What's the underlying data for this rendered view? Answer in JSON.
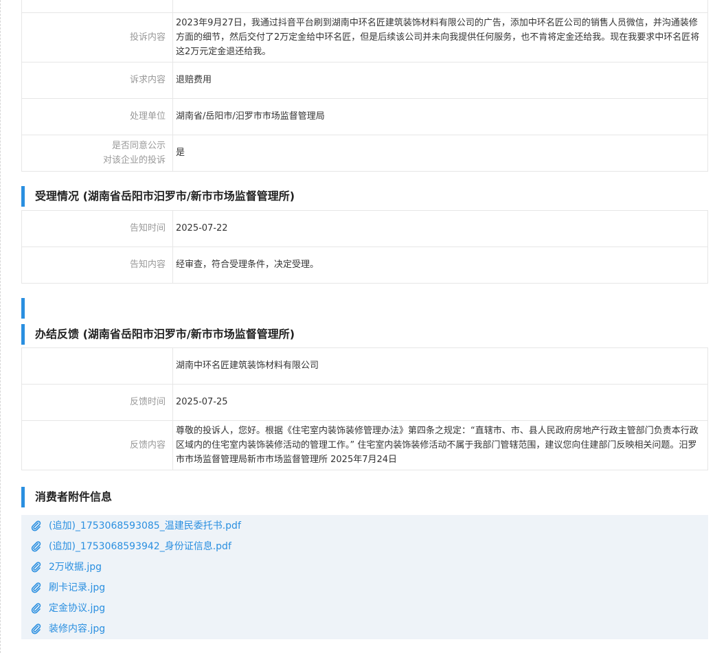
{
  "complaint_table": {
    "rows": [
      {
        "label": "投诉内容",
        "value": "2023年9月27日，我通过抖音平台刷到湖南中环名匠建筑装饰材料有限公司的广告，添加中环名匠公司的销售人员微信，并沟通装修方面的细节，然后交付了2万定金给中环名匠，但是后续该公司并未向我提供任何服务，也不肯将定金还给我。现在我要求中环名匠将这2万元定金退还给我。"
      },
      {
        "label": "诉求内容",
        "value": "退赔费用"
      },
      {
        "label": "处理单位",
        "value": "湖南省/岳阳市/汨罗市市场监督管理局"
      },
      {
        "label_line1": "是否同意公示",
        "label_line2": "对该企业的投诉",
        "value": "是"
      }
    ]
  },
  "acceptance": {
    "title": "受理情况 (湖南省岳阳市汨罗市/新市市场监督管理所)",
    "rows": [
      {
        "label": "告知时间",
        "value": "2025-07-22"
      },
      {
        "label": "告知内容",
        "value": "经审查，符合受理条件，决定受理。"
      }
    ]
  },
  "feedback": {
    "title": "办结反馈 (湖南省岳阳市汨罗市/新市市场监督管理所)",
    "rows": [
      {
        "label": "",
        "value": "湖南中环名匠建筑装饰材料有限公司"
      },
      {
        "label": "反馈时间",
        "value": "2025-07-25"
      },
      {
        "label": "反馈内容",
        "value": "尊敬的投诉人，您好。根据《住宅室内装饰装修管理办法》第四条之规定：“直辖市、市、县人民政府房地产行政主管部门负责本行政区域内的住宅室内装饰装修活动的管理工作。” 住宅室内装饰装修活动不属于我部门管辖范围，建议您向住建部门反映相关问题。汨罗市市场监督管理局新市市场监督管理所 2025年7月24日"
      }
    ]
  },
  "attachments": {
    "title": "消费者附件信息",
    "icon": "paperclip-icon",
    "files": [
      "(追加)_1753068593085_温建民委托书.pdf",
      "(追加)_1753068593942_身份证信息.pdf",
      "2万收据.jpg",
      "刷卡记录.jpg",
      "定金协议.jpg",
      "装修内容.jpg"
    ]
  },
  "colors": {
    "accent": "#2a8fe0",
    "label": "#999999",
    "border": "#e6e6e6",
    "attach_bg": "#eef3f8"
  }
}
